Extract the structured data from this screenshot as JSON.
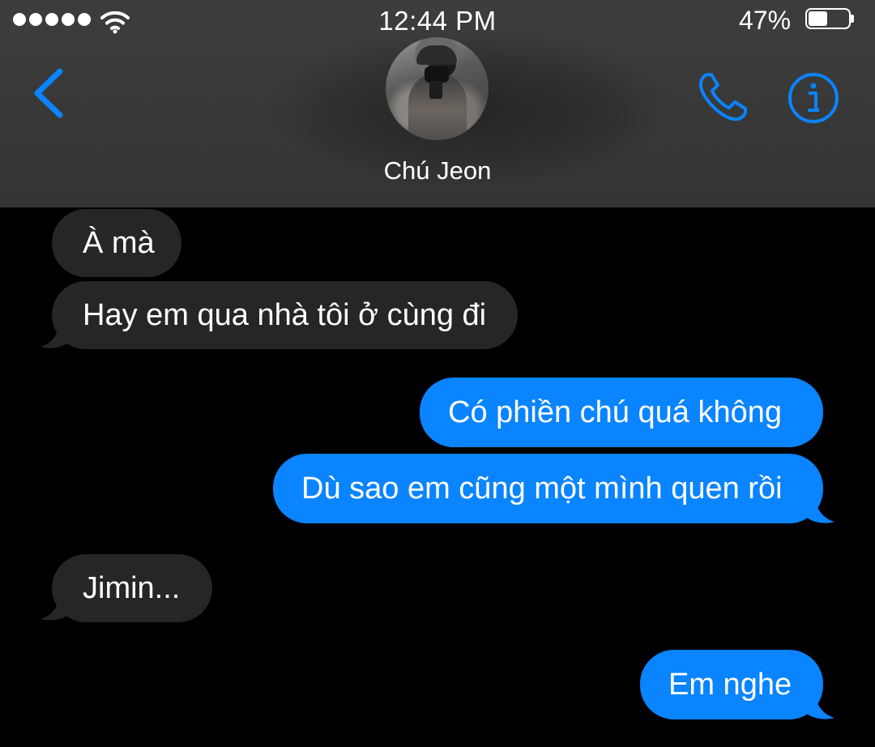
{
  "status_bar": {
    "signal_dots": 5,
    "time": "12:44 PM",
    "battery_percent": "47%",
    "battery_level": 0.47
  },
  "header": {
    "back_icon": "chevron-left-icon",
    "contact_name": "Chú Jeon",
    "call_icon": "phone-icon",
    "info_icon": "info-icon",
    "accent_color": "#0a84ff"
  },
  "messages": [
    {
      "direction": "incoming",
      "text": "À mà"
    },
    {
      "direction": "incoming",
      "text": "Hay em qua nhà tôi ở cùng đi"
    },
    {
      "direction": "outgoing",
      "text": "Có phiền chú quá không"
    },
    {
      "direction": "outgoing",
      "text": "Dù sao em cũng một mình quen rồi"
    },
    {
      "direction": "incoming",
      "text": "Jimin..."
    },
    {
      "direction": "outgoing",
      "text": "Em nghe"
    }
  ],
  "colors": {
    "background": "#000000",
    "incoming_bubble": "#262628",
    "outgoing_bubble": "#0a84ff",
    "header_bg": "#3a3a3a"
  }
}
